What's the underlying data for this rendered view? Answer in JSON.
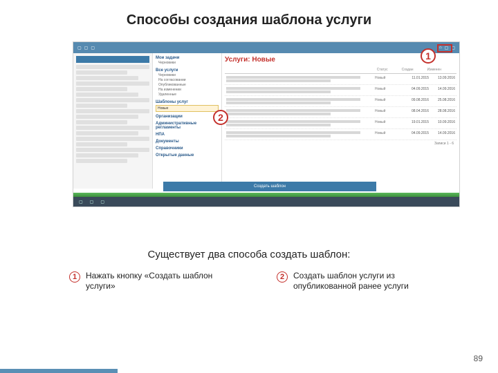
{
  "title": "Способы создания шаблона услуги",
  "markers": {
    "m1": "1",
    "m2": "2"
  },
  "screenshot": {
    "main_heading": "Услуги: Новые",
    "cols": {
      "status": "Статус",
      "created": "Создан",
      "edited": "Изменен"
    },
    "rows": [
      {
        "status": "Новый",
        "created": "11.01.2015",
        "edited": "13.09.2016"
      },
      {
        "status": "Новый",
        "created": "04.09.2015",
        "edited": "14.09.2016"
      },
      {
        "status": "Новый",
        "created": "09.08.2016",
        "edited": "25.08.2016"
      },
      {
        "status": "Новый",
        "created": "08.04.2016",
        "edited": "28.08.2016"
      },
      {
        "status": "Новый",
        "created": "19.01.2015",
        "edited": "10.09.2016"
      },
      {
        "status": "Новый",
        "created": "04.09.2015",
        "edited": "14.09.2016"
      }
    ],
    "records": "Записи 1 - 6",
    "create_template_btn": "Создать шаблон",
    "mid": {
      "g1": {
        "hd": "Мои задачи",
        "i1": "Черновики"
      },
      "g2": {
        "hd": "Все услуги",
        "i1": "Черновики",
        "i2": "На согласовании",
        "i3": "Опубликованные",
        "i4": "На изменении",
        "i5": "Удаленные"
      },
      "g3": {
        "hd": "Шаблоны услуг",
        "i1": "Новые"
      },
      "g4": {
        "hd": "Организации"
      },
      "g5": {
        "hd": "Административные регламенты"
      },
      "g6": {
        "hd": "НПА"
      },
      "g7": {
        "hd": "Документы"
      },
      "g8": {
        "hd": "Справочники"
      },
      "g9": {
        "hd": "Открытые данные"
      },
      "highlight": "Новые"
    }
  },
  "subtitle": "Существует два способа создать шаблон:",
  "legend": [
    {
      "num": "1",
      "text": "Нажать кнопку «Создать шаблон услуги»"
    },
    {
      "num": "2",
      "text": "Создать шаблон услуги из опубликованной ранее услуги"
    }
  ],
  "page_number": "89"
}
